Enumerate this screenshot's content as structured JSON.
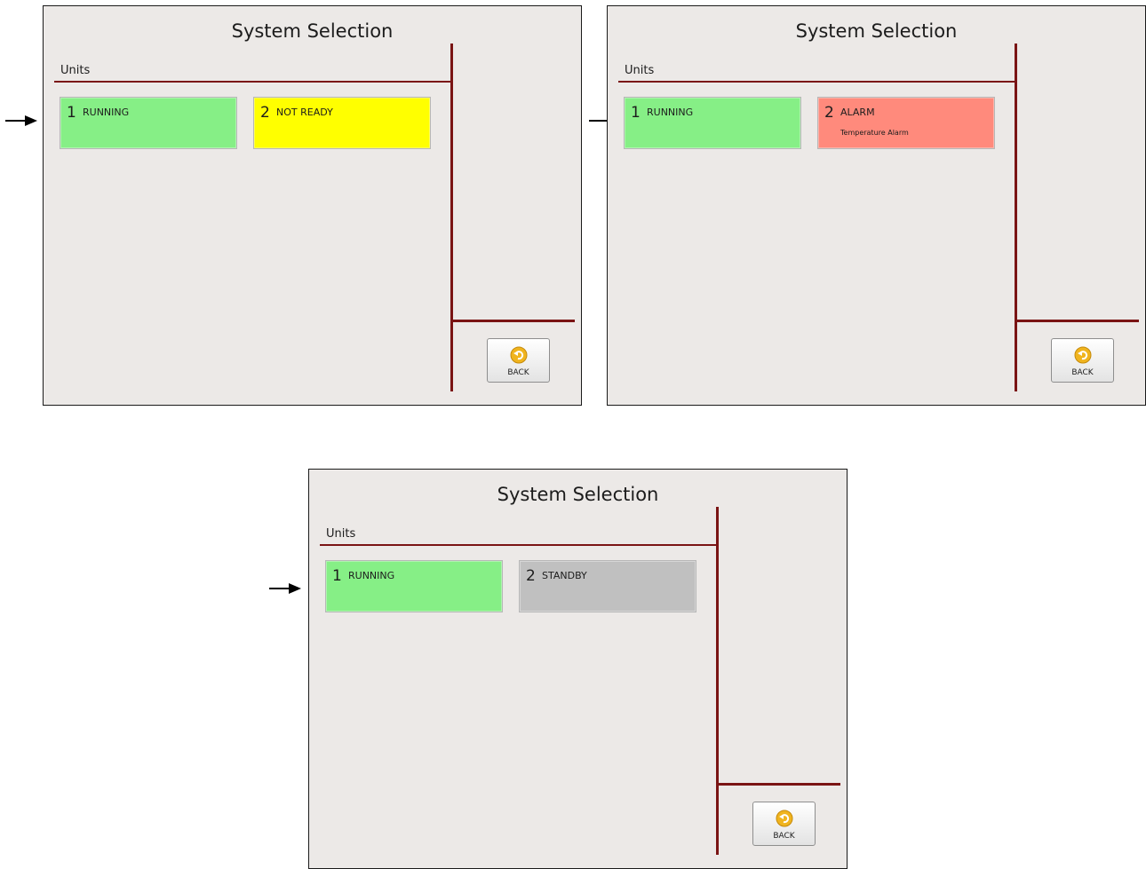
{
  "colors": {
    "running": "#86ef86",
    "not_ready": "#ffff00",
    "alarm": "#ff8a7c",
    "standby": "#c0c0c0",
    "divider": "#7a1414"
  },
  "screens": [
    {
      "title": "System Selection",
      "units_label": "Units",
      "tiles": [
        {
          "num": "1",
          "status": "RUNNING",
          "sub": "",
          "color": "#86ef86"
        },
        {
          "num": "2",
          "status": "NOT READY",
          "sub": "",
          "color": "#ffff00"
        }
      ],
      "back_label": "BACK",
      "back_icon": "back-arrow-icon",
      "pointer_icon": "arrow-right-icon"
    },
    {
      "title": "System Selection",
      "units_label": "Units",
      "tiles": [
        {
          "num": "1",
          "status": "RUNNING",
          "sub": "",
          "color": "#86ef86"
        },
        {
          "num": "2",
          "status": "ALARM",
          "sub": "Temperature Alarm",
          "color": "#ff8a7c"
        }
      ],
      "back_label": "BACK",
      "back_icon": "back-arrow-icon",
      "pointer_icon": "arrow-right-icon"
    },
    {
      "title": "System Selection",
      "units_label": "Units",
      "tiles": [
        {
          "num": "1",
          "status": "RUNNING",
          "sub": "",
          "color": "#86ef86"
        },
        {
          "num": "2",
          "status": "STANDBY",
          "sub": "",
          "color": "#c0c0c0"
        }
      ],
      "back_label": "BACK",
      "back_icon": "back-arrow-icon",
      "pointer_icon": "arrow-right-icon"
    }
  ]
}
